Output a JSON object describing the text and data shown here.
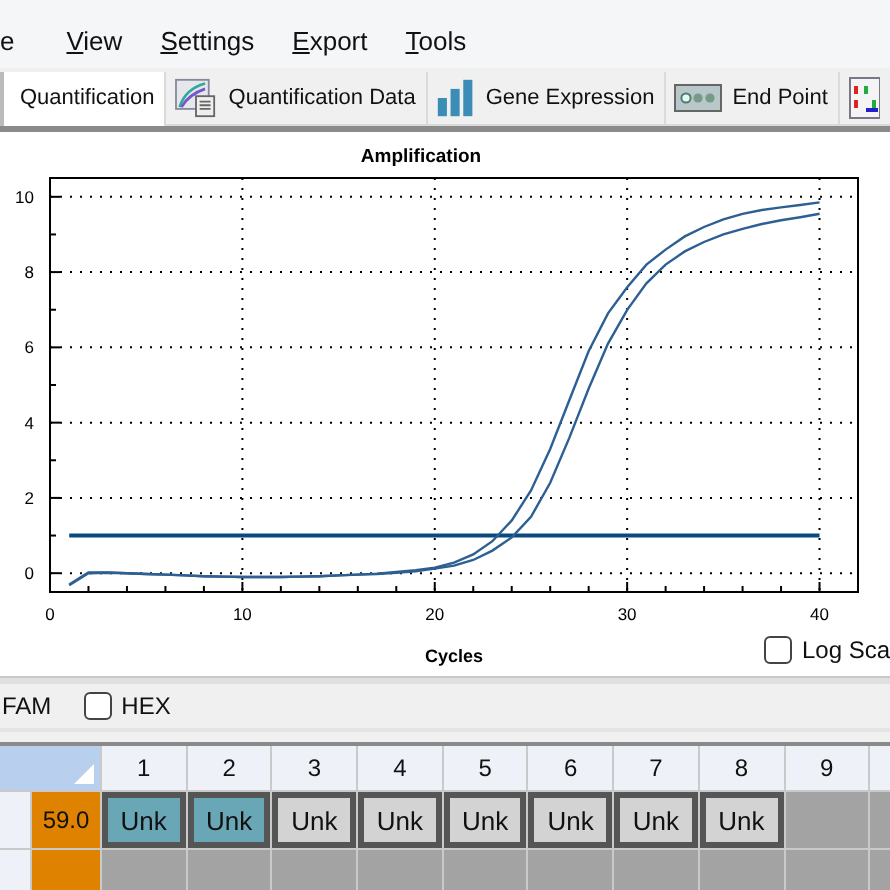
{
  "menu": [
    "e",
    "View",
    "Settings",
    "Export",
    "Tools"
  ],
  "tabs": [
    {
      "label": "Quantification",
      "selected": true
    },
    {
      "label": "Quantification Data",
      "selected": false
    },
    {
      "label": "Gene Expression",
      "selected": false
    },
    {
      "label": "End Point",
      "selected": false
    },
    {
      "selected": false
    }
  ],
  "chart": {
    "log_scale": {
      "label": "Log Sca",
      "checked": false
    },
    "chart_data": {
      "type": "line",
      "title": "Amplification",
      "xlabel": "Cycles",
      "xlim": [
        0,
        42
      ],
      "ylim": [
        -0.5,
        10.5
      ],
      "xticks": [
        0,
        10,
        20,
        30,
        40
      ],
      "yticks": [
        0,
        2,
        4,
        6,
        8,
        10
      ],
      "grid": true,
      "x": [
        1,
        2,
        3,
        4,
        5,
        6,
        7,
        8,
        9,
        10,
        11,
        12,
        13,
        14,
        15,
        16,
        17,
        18,
        19,
        20,
        21,
        22,
        23,
        24,
        25,
        26,
        27,
        28,
        29,
        30,
        31,
        32,
        33,
        34,
        35,
        36,
        37,
        38,
        39,
        40
      ],
      "series": [
        {
          "color": "#2d5f93",
          "values": [
            -0.3,
            0.02,
            0.02,
            0.0,
            -0.02,
            -0.04,
            -0.06,
            -0.08,
            -0.09,
            -0.1,
            -0.1,
            -0.1,
            -0.09,
            -0.08,
            -0.06,
            -0.04,
            -0.01,
            0.03,
            0.08,
            0.15,
            0.28,
            0.5,
            0.85,
            1.4,
            2.2,
            3.3,
            4.6,
            5.9,
            6.9,
            7.6,
            8.2,
            8.6,
            8.95,
            9.2,
            9.4,
            9.55,
            9.65,
            9.72,
            9.78,
            9.85
          ]
        },
        {
          "color": "#2d5f93",
          "values": [
            -0.32,
            0.0,
            0.01,
            0.0,
            -0.02,
            -0.04,
            -0.06,
            -0.08,
            -0.09,
            -0.1,
            -0.1,
            -0.1,
            -0.09,
            -0.08,
            -0.06,
            -0.04,
            -0.02,
            0.01,
            0.05,
            0.12,
            0.2,
            0.35,
            0.6,
            0.95,
            1.5,
            2.4,
            3.6,
            4.9,
            6.1,
            7.0,
            7.7,
            8.2,
            8.55,
            8.8,
            9.0,
            9.15,
            9.28,
            9.38,
            9.46,
            9.55
          ]
        }
      ],
      "ref_lines": [
        {
          "axis": "y",
          "value": 1
        }
      ]
    }
  },
  "channels": [
    {
      "label": "FAM"
    },
    {
      "label": "HEX",
      "checked": false
    }
  ],
  "plate": {
    "columns": [
      "1",
      "2",
      "3",
      "4",
      "5",
      "6",
      "7",
      "8",
      "9"
    ],
    "rows": [
      {
        "value": "59.0",
        "wells": [
          {
            "label": "Unk",
            "selected": true
          },
          {
            "label": "Unk",
            "selected": true
          },
          {
            "label": "Unk",
            "selected": false
          },
          {
            "label": "Unk",
            "selected": false
          },
          {
            "label": "Unk",
            "selected": false
          },
          {
            "label": "Unk",
            "selected": false
          },
          {
            "label": "Unk",
            "selected": false
          },
          {
            "label": "Unk",
            "selected": false
          }
        ]
      }
    ]
  }
}
